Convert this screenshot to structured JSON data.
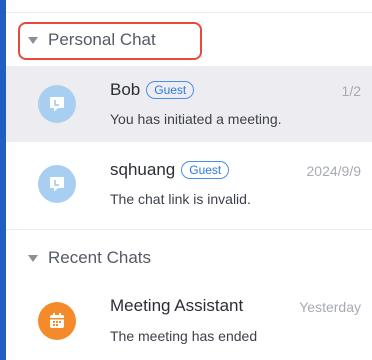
{
  "sections": {
    "personal": {
      "label": "Personal Chat"
    },
    "recent": {
      "label": "Recent Chats"
    }
  },
  "chats": [
    {
      "name": "Bob",
      "badge": "Guest",
      "time": "1/2",
      "preview": "You has initiated a meeting.",
      "avatar_icon": "chat-bubble-icon",
      "avatar_color": "#a8cff2",
      "selected": true
    },
    {
      "name": "sqhuang",
      "badge": "Guest",
      "time": "2024/9/9",
      "preview": "The chat link is invalid.",
      "avatar_icon": "chat-bubble-icon",
      "avatar_color": "#a8cff2",
      "selected": false
    },
    {
      "name": "Meeting Assistant",
      "time": "Yesterday",
      "preview": "The meeting has ended",
      "avatar_icon": "calendar-icon",
      "avatar_color": "#f58a2b",
      "selected": false
    }
  ],
  "colors": {
    "accent_bar": "#1f5fc2",
    "highlight_border": "#e64a3c",
    "guest_badge": "#2d7be0",
    "selected_row": "#ededf1"
  }
}
